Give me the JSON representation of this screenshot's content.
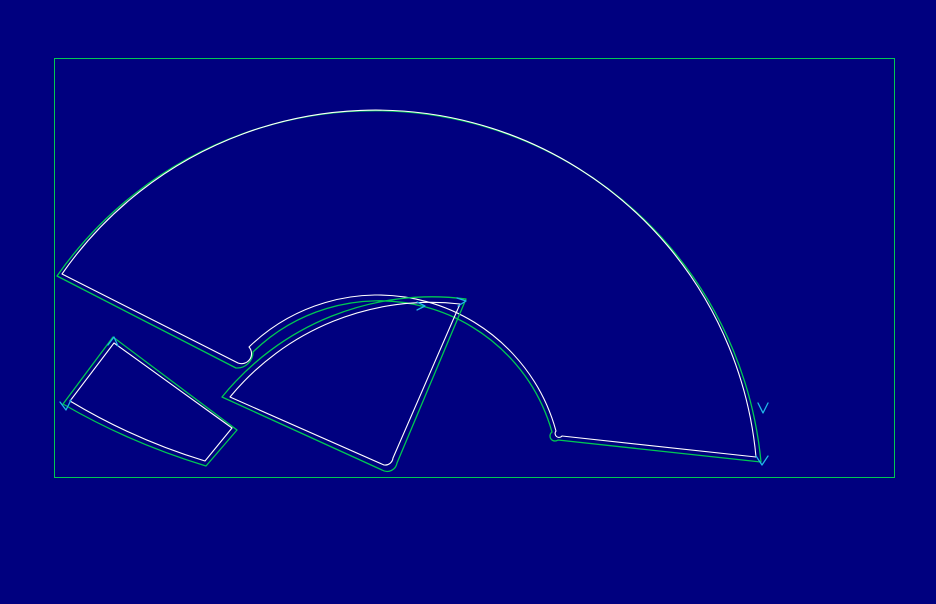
{
  "canvas": {
    "background": "#00007f"
  },
  "colors": {
    "board": "#00c853",
    "outline": "#ffffff",
    "toolpath": "#00c853",
    "direction_arrow": "#20b8e8"
  },
  "parts": [
    {
      "id": "large-arc-sector",
      "kind": "annular-sector"
    },
    {
      "id": "quad-piece",
      "kind": "quadrilateral"
    },
    {
      "id": "pie-sector",
      "kind": "circular-sector"
    }
  ],
  "direction_markers": 6
}
